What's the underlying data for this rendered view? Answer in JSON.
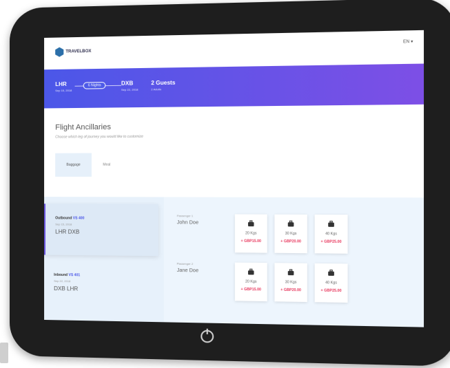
{
  "header": {
    "brand": "TRAVELBOX",
    "language": "EN"
  },
  "trip": {
    "from": {
      "code": "LHR",
      "date": "Sep 15, 2018"
    },
    "nights": "6 Nights",
    "to": {
      "code": "DXB",
      "date": "Sep 22, 2018"
    },
    "guests": {
      "title": "2 Guests",
      "sub": "2 Adults"
    }
  },
  "page": {
    "title": "Flight Ancillaries",
    "subtitle": "Choose which leg of journey you would like to customize"
  },
  "tabs": [
    {
      "label": "Baggage"
    },
    {
      "label": "Meal"
    }
  ],
  "legs": [
    {
      "label": "Outbound",
      "flight": "VS 400",
      "date": "Sep 15, 2018",
      "route": "LHR DXB"
    },
    {
      "label": "Inbound",
      "flight": "VS 401",
      "date": "Sep 22, 2018",
      "route": "DXB LHR"
    }
  ],
  "passengers": [
    {
      "label": "Passenger 1",
      "name": "John Doe",
      "options": [
        {
          "weight": "20 Kgs",
          "price": "+ GBP15.00"
        },
        {
          "weight": "30 Kgs",
          "price": "+ GBP20.00"
        },
        {
          "weight": "40 Kgs",
          "price": "+ GBP25.00"
        }
      ]
    },
    {
      "label": "Passenger 2",
      "name": "Jane Doe",
      "options": [
        {
          "weight": "20 Kgs",
          "price": "+ GBP15.00"
        },
        {
          "weight": "30 Kgs",
          "price": "+ GBP20.00"
        },
        {
          "weight": "40 Kgs",
          "price": "+ GBP25.00"
        }
      ]
    }
  ],
  "icons": {
    "baggage": "suitcase-icon",
    "power": "power-icon"
  },
  "colors": {
    "accent": "#4b57e8",
    "price": "#e8375d",
    "panel": "#e7f1fb"
  }
}
